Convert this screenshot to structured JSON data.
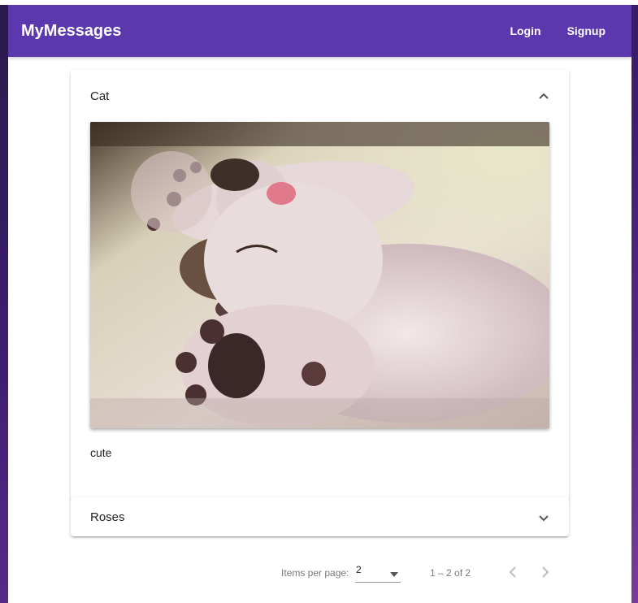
{
  "app": {
    "title": "MyMessages",
    "nav": {
      "login": "Login",
      "signup": "Signup"
    }
  },
  "messages": [
    {
      "title": "Cat",
      "expanded": true,
      "content": "cute",
      "image_icon": "cat-photo"
    },
    {
      "title": "Roses",
      "expanded": false
    }
  ],
  "paginator": {
    "items_per_page_label": "Items per page:",
    "page_size": "2",
    "range_label": "1 – 2 of 2",
    "prev_icon": "chevron-left-icon",
    "next_icon": "chevron-right-icon"
  },
  "colors": {
    "toolbar": "#5c38ae",
    "background": "#3b1d6e"
  }
}
